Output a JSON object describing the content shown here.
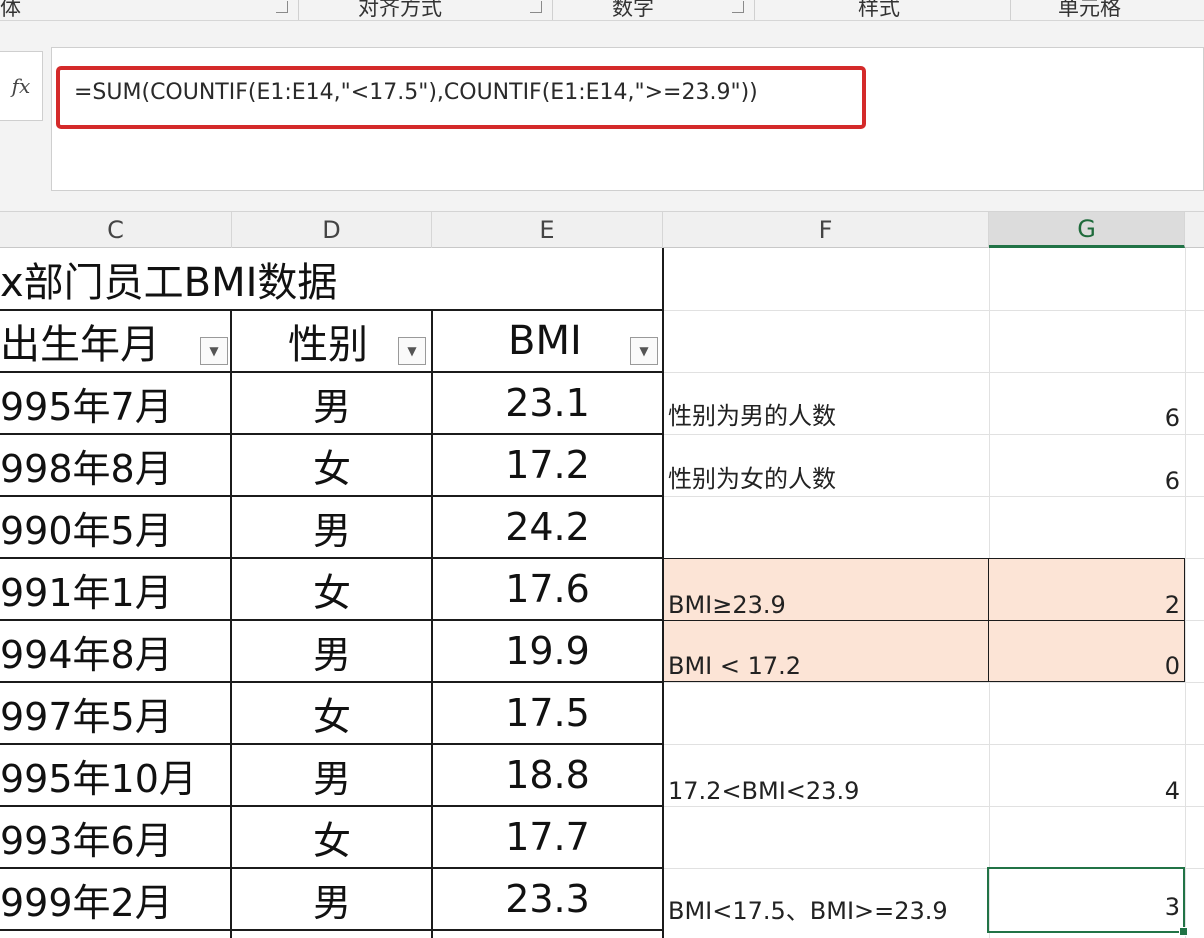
{
  "ribbon": {
    "groups": [
      {
        "label": "体"
      },
      {
        "label": "对齐方式"
      },
      {
        "label": "数字"
      },
      {
        "label": "样式"
      },
      {
        "label": "单元格"
      }
    ]
  },
  "formula_bar": {
    "fx_label": "fx",
    "formula": "=SUM(COUNTIF(E1:E14,\"<17.5\"),COUNTIF(E1:E14,\">=23.9\"))"
  },
  "columns": [
    "C",
    "D",
    "E",
    "F",
    "G"
  ],
  "selected_column": "G",
  "table": {
    "title": "x部门员工BMI数据",
    "headers": [
      "出生年月",
      "性别",
      "BMI"
    ],
    "rows": [
      [
        "995年7月",
        "男",
        "23.1"
      ],
      [
        "998年8月",
        "女",
        "17.2"
      ],
      [
        "990年5月",
        "男",
        "24.2"
      ],
      [
        "991年1月",
        "女",
        "17.6"
      ],
      [
        "994年8月",
        "男",
        "19.9"
      ],
      [
        "997年5月",
        "女",
        "17.5"
      ],
      [
        "995年10月",
        "男",
        "18.8"
      ],
      [
        "993年6月",
        "女",
        "17.7"
      ],
      [
        "999年2月",
        "男",
        "23.3"
      ]
    ]
  },
  "stats": [
    {
      "label": "性别为男的人数",
      "value": "6"
    },
    {
      "label": "性别为女的人数",
      "value": "6"
    },
    {
      "label": "BMI≥23.9",
      "value": "2"
    },
    {
      "label": "BMI < 17.2",
      "value": "0"
    },
    {
      "label": "17.2<BMI<23.9",
      "value": "4"
    },
    {
      "label": "BMI<17.5、BMI>=23.9",
      "value": "3"
    }
  ],
  "colors": {
    "highlight_fill": "#fce4d6",
    "formula_outline": "#d42a2a",
    "selection_green": "#217346"
  }
}
